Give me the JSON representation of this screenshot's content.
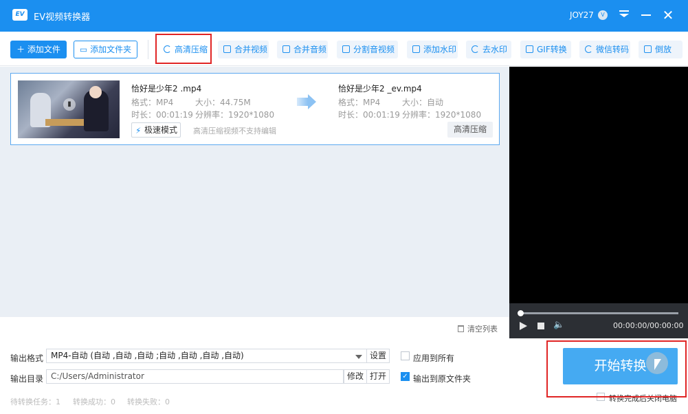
{
  "window": {
    "logo_text": "EV",
    "title": "EV视频转换器",
    "user_name": "JOY27",
    "user_badge": "V"
  },
  "toolbar": {
    "add_file": "添加文件",
    "add_folder": "添加文件夹",
    "tools": [
      {
        "label": "高清压缩",
        "icon": "compress-icon"
      },
      {
        "label": "合并视频",
        "icon": "merge-video-icon"
      },
      {
        "label": "合并音频",
        "icon": "merge-audio-icon"
      },
      {
        "label": "分割音视频",
        "icon": "split-icon"
      },
      {
        "label": "添加水印",
        "icon": "watermark-icon"
      },
      {
        "label": "去水印",
        "icon": "remove-watermark-icon"
      },
      {
        "label": "GIF转换",
        "icon": "gif-icon"
      },
      {
        "label": "微信转码",
        "icon": "wechat-icon"
      },
      {
        "label": "倒放",
        "icon": "reverse-icon"
      }
    ],
    "highlighted_tool": "高清压缩"
  },
  "file": {
    "source": {
      "name": "恰好是少年2 .mp4",
      "format": "格式：MP4",
      "size": "大小：44.75M",
      "duration": "时长：00:01:19",
      "resolution": "分辨率：1920*1080"
    },
    "output": {
      "name": "恰好是少年2 _ev.mp4",
      "format": "格式：MP4",
      "size": "大小：自动",
      "duration": "时长：00:01:19",
      "resolution": "分辨率：1920*1080"
    },
    "speed_mode": "极速模式",
    "note": "高清压缩视频不支持编辑",
    "mode_badge": "高清压缩"
  },
  "player": {
    "time": "00:00:00/00:00:00",
    "progress": 0
  },
  "list": {
    "clear": "清空列表"
  },
  "settings": {
    "format_label": "输出格式",
    "format_value": "MP4-自动 (自动 ,自动 ,自动 ;自动 ,自动 ,自动 ,自动)",
    "settings_btn": "设置",
    "apply_all": "应用到所有",
    "apply_all_checked": false,
    "dir_label": "输出目录",
    "dir_value": "C:/Users/Administrator",
    "modify_btn": "修改",
    "open_btn": "打开",
    "output_to_source": "输出到原文件夹",
    "output_to_source_checked": true
  },
  "status": {
    "pending": "待转换任务：1",
    "success": "转换成功：0",
    "failed": "转换失败：0"
  },
  "start": {
    "label": "开始转换",
    "shutdown_label": "转换完成后关闭电脑",
    "shutdown_checked": false
  },
  "colors": {
    "accent": "#1b8ff0",
    "highlight": "#e02424",
    "start_button": "#45aaf2"
  }
}
